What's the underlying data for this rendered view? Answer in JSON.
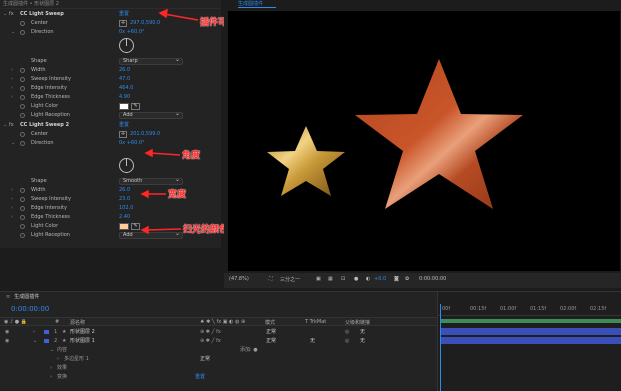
{
  "effect_controls": {
    "breadcrumb": "生成圆插件 • 形状图层 2",
    "effect1": {
      "name": "CC Light Sweep",
      "reset": "重置",
      "center_label": "Center",
      "center_value": "297.0,590.0",
      "direction_label": "Direction",
      "direction_value": "0x +60.0°",
      "shape_label": "Shape",
      "shape_value": "Sharp",
      "width_label": "Width",
      "width_value": "26.0",
      "sweep_intensity_label": "Sweep Intensity",
      "sweep_intensity_value": "47.0",
      "edge_intensity_label": "Edge Intensity",
      "edge_intensity_value": "464.0",
      "edge_thickness_label": "Edge Thickness",
      "edge_thickness_value": "4.90",
      "light_color_label": "Light Color",
      "light_color_hex": "#ffffff",
      "light_reception_label": "Light Reception",
      "light_reception_value": "Add"
    },
    "effect2": {
      "name": "CC Light Sweep 2",
      "reset": "重置",
      "center_label": "Center",
      "center_value": "201.0,599.0",
      "direction_label": "Direction",
      "direction_value": "0x +60.0°",
      "shape_label": "Shape",
      "shape_value": "Smooth",
      "width_label": "Width",
      "width_value": "26.0",
      "sweep_intensity_label": "Sweep Intensity",
      "sweep_intensity_value": "23.0",
      "edge_intensity_label": "Edge Intensity",
      "edge_intensity_value": "102.0",
      "edge_thickness_label": "Edge Thickness",
      "edge_thickness_value": "2.40",
      "light_color_label": "Light Color",
      "light_color_hex": "#ffcc99",
      "light_reception_label": "Light Reception",
      "light_reception_value": "Add"
    }
  },
  "annotations": {
    "copy_note": "插件可复制多个叠加使用",
    "angle_note": "角度",
    "width_note": "宽度",
    "color_note": "扫光的颜色"
  },
  "composition": {
    "tab_label": "生成圆插件",
    "zoom": "(47.8%)",
    "resolution": "三分之一",
    "exposure": "+0.0",
    "timecode": "0:00:00:00"
  },
  "timeline": {
    "comp_name": "生成圆插件",
    "timecode": "0:00:00:00",
    "col_source_name": "源名称",
    "col_mode": "模式",
    "col_trkmat": "T  TrkMat",
    "col_parent": "父级和链接",
    "layers": [
      {
        "num": "1",
        "name": "形状图层 2",
        "mode": "正常",
        "trkmat": "",
        "parent": "无"
      },
      {
        "num": "2",
        "name": "形状图层 1",
        "mode": "正常",
        "trkmat": "无",
        "parent": "无"
      }
    ],
    "sub_content": "内容",
    "sub_add": "添加: ●",
    "sub_polystar": "多边星形 1",
    "sub_polystar_mode": "正常",
    "sub_effects": "效果",
    "sub_transform": "变换",
    "sub_reset": "重置",
    "ruler_ticks": [
      "00f",
      "00:15f",
      "01:00f",
      "01:15f",
      "02:00f",
      "02:15f"
    ]
  },
  "colors": {
    "accent_blue": "#2d8ceb",
    "annotation_red": "#ff2626",
    "layer_bar_blue": "#3b4fb8",
    "layer_bar_green": "#3d8c5a"
  }
}
